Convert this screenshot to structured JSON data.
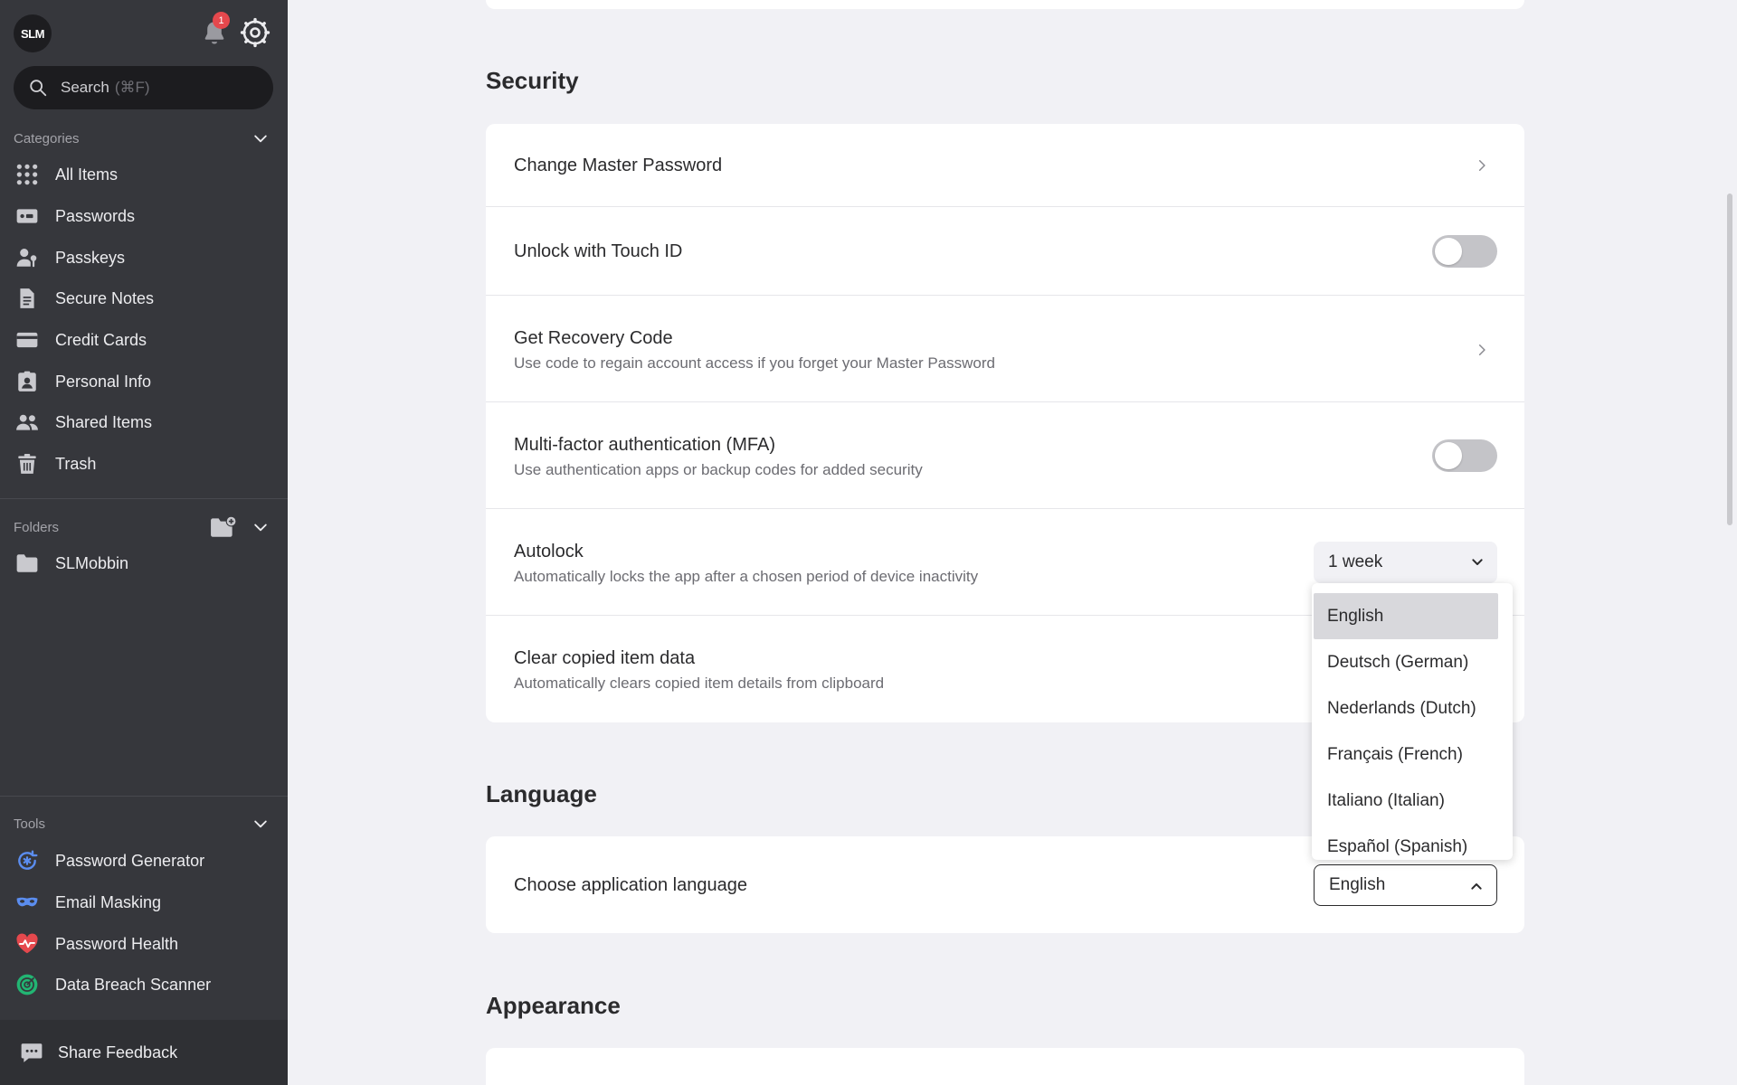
{
  "sidebar": {
    "logo": "SLM",
    "notifications_count": "1",
    "search_placeholder": "Search",
    "search_shortcut": "(⌘F)",
    "categories_label": "Categories",
    "categories": [
      {
        "label": "All Items",
        "icon": "grid-icon"
      },
      {
        "label": "Passwords",
        "icon": "password-icon"
      },
      {
        "label": "Passkeys",
        "icon": "passkey-icon"
      },
      {
        "label": "Secure Notes",
        "icon": "note-icon"
      },
      {
        "label": "Credit Cards",
        "icon": "credit-card-icon"
      },
      {
        "label": "Personal Info",
        "icon": "id-badge-icon"
      },
      {
        "label": "Shared Items",
        "icon": "users-icon"
      },
      {
        "label": "Trash",
        "icon": "trash-icon"
      }
    ],
    "folders_label": "Folders",
    "folders": [
      {
        "label": "SLMobbin",
        "icon": "folder-icon"
      }
    ],
    "tools_label": "Tools",
    "tools": [
      {
        "label": "Password Generator",
        "icon": "generator-icon",
        "color": "#5b8def"
      },
      {
        "label": "Email Masking",
        "icon": "mask-icon",
        "color": "#5b8def"
      },
      {
        "label": "Password Health",
        "icon": "heart-pulse-icon",
        "color": "#e5484d"
      },
      {
        "label": "Data Breach Scanner",
        "icon": "radar-icon",
        "color": "#22b573"
      }
    ],
    "feedback_label": "Share Feedback"
  },
  "security": {
    "heading": "Security",
    "rows": [
      {
        "title": "Change Master Password",
        "subtitle": "",
        "control": "chevron"
      },
      {
        "title": "Unlock with Touch ID",
        "subtitle": "",
        "control": "toggle",
        "on": false
      },
      {
        "title": "Get Recovery Code",
        "subtitle": "Use code to regain account access if you forget your Master Password",
        "control": "chevron"
      },
      {
        "title": "Multi-factor authentication (MFA)",
        "subtitle": "Use authentication apps or backup codes for added security",
        "control": "toggle",
        "on": false
      },
      {
        "title": "Autolock",
        "subtitle": "Automatically locks the app after a chosen period of device inactivity",
        "control": "select",
        "value": "1 week"
      },
      {
        "title": "Clear copied item data",
        "subtitle": "Automatically clears copied item details from clipboard",
        "control": "none"
      }
    ]
  },
  "language": {
    "heading": "Language",
    "row_title": "Choose application language",
    "selected": "English",
    "options": [
      "English",
      "Deutsch (German)",
      "Nederlands (Dutch)",
      "Français (French)",
      "Italiano (Italian)",
      "Español (Spanish)"
    ]
  },
  "appearance": {
    "heading": "Appearance"
  },
  "colors": {
    "sidebar_bg": "#36373c",
    "main_bg": "#f1f1f5",
    "badge": "#e5484d"
  }
}
